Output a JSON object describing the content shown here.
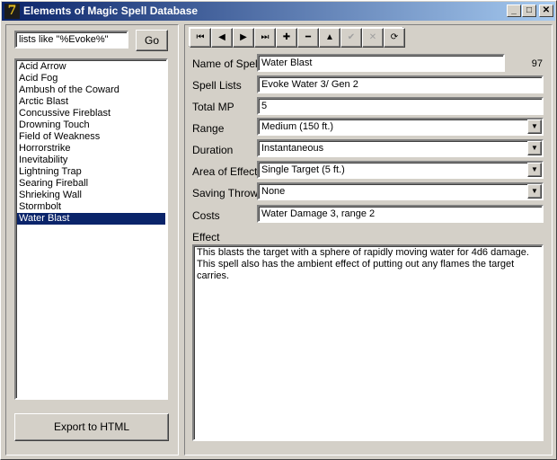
{
  "window": {
    "title": "Elements of Magic Spell Database",
    "icon_letter": "7",
    "minimize_label": "_",
    "maximize_label": "□",
    "close_label": "✕"
  },
  "left": {
    "filter_value": "lists like \"%Evoke%\"",
    "go_label": "Go",
    "spells": [
      "Acid Arrow",
      "Acid Fog",
      "Ambush of the Coward",
      "Arctic Blast",
      "Concussive Fireblast",
      "Drowning Touch",
      "Field of Weakness",
      "Horrorstrike",
      "Inevitability",
      "Lightning Trap",
      "Searing Fireball",
      "Shrieking Wall",
      "Stormbolt",
      "Water Blast"
    ],
    "selected_index": 13,
    "export_label": "Export to HTML"
  },
  "toolbar": {
    "first_icon": "⏮",
    "prior_icon": "◀",
    "next_icon": "▶",
    "last_icon": "⏭",
    "insert_icon": "✚",
    "delete_icon": "━",
    "edit_icon": "▲",
    "post_icon": "✔",
    "cancel_icon": "✕",
    "refresh_icon": "⟳"
  },
  "form": {
    "name_label": "Name of Spell",
    "name_value": "Water Blast",
    "record_number": "97",
    "lists_label": "Spell Lists",
    "lists_value": "Evoke Water 3/ Gen 2",
    "mp_label": "Total MP",
    "mp_value": "5",
    "range_label": "Range",
    "range_value": "Medium (150 ft.)",
    "duration_label": "Duration",
    "duration_value": "Instantaneous",
    "area_label": "Area of Effect",
    "area_value": "Single Target (5 ft.)",
    "saving_label": "Saving Throw",
    "saving_value": "None",
    "costs_label": "Costs",
    "costs_value": "Water Damage 3, range 2",
    "effect_label": "Effect",
    "effect_value": "This blasts the target with a sphere of rapidly moving water for 4d6 damage. This spell also has the ambient effect of putting out any flames the target carries."
  }
}
